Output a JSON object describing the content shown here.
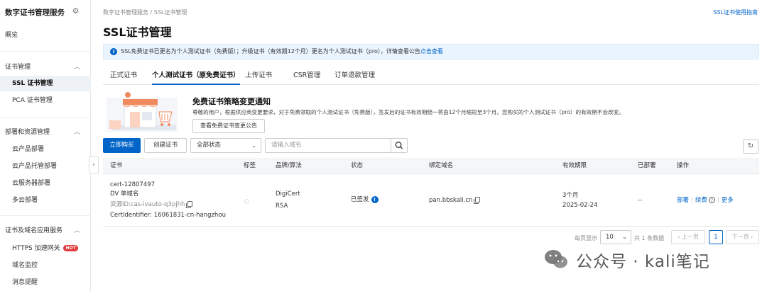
{
  "sidebar": {
    "title": "数字证书管理服务",
    "items": [
      {
        "label": "概览"
      },
      {
        "label": "证书管理"
      },
      {
        "label": "SSL 证书管理"
      },
      {
        "label": "PCA 证书管理"
      },
      {
        "label": "部署和资源管理"
      },
      {
        "label": "云产品部署"
      },
      {
        "label": "云产品托管部署"
      },
      {
        "label": "云服务器部署"
      },
      {
        "label": "多云部署"
      },
      {
        "label": "证书及域名应用服务"
      },
      {
        "label": "HTTPS 加速网关",
        "badge": "HOT"
      },
      {
        "label": "域名监控"
      },
      {
        "label": "消息提醒"
      }
    ]
  },
  "header": {
    "breadcrumb": "数字证书管理服务  /  SSL证书管理",
    "help_link": "SSL证书使用指南",
    "title": "SSL证书管理"
  },
  "notice": {
    "text": "SSL免费证书已更名为个人测试证书（免费版）；升级证书（有效期12个月）更名为个人测试证书（pro），详情查看公告",
    "link": "点击查看"
  },
  "tabs": [
    {
      "label": "正式证书"
    },
    {
      "label": "个人测试证书（原免费证书）"
    },
    {
      "label": "上传证书"
    },
    {
      "label": "CSR管理"
    },
    {
      "label": "订单退款管理"
    }
  ],
  "banner": {
    "title": "免费证书策略变更通知",
    "text": "尊敬的用户，根据供应商变更要求，对于免费领取的个人测试证书（免费版），签发后的证书有效期统一将由12个月缩短至3个月。您购买的个人测试证书（pro）的有效期不会改变。",
    "button": "查看免费证书变更公告"
  },
  "toolbar": {
    "buy": "立即购买",
    "create": "创建证书",
    "status_select": "全部状态",
    "search_placeholder": "请输入域名"
  },
  "table": {
    "headers": [
      "证书",
      "标签",
      "品牌/算法",
      "状态",
      "绑定域名",
      "有效期限",
      "已部署",
      "操作"
    ],
    "rows": [
      {
        "cert_name": "cert-12807497",
        "cert_type": "DV 单域名",
        "resource_id": "资源ID:cas-ivauto-q3pjhh",
        "cert_identifier": "CertIdentifier: 16061831-cn-hangzhou",
        "brand": "DigiCert",
        "algo": "RSA",
        "status": "已签发",
        "domain": "pan.bbskali.cn",
        "validity": "3个月",
        "expire": "2025-02-24",
        "deployed": "--",
        "actions": [
          "部署",
          "续费",
          "更多"
        ]
      }
    ]
  },
  "pager": {
    "per_page_label": "每页显示",
    "per_page": "10",
    "total": "共 1 条数据",
    "prev": "上一页",
    "page": "1",
    "next": "下一页"
  },
  "watermark": {
    "text": "公众号 · kali笔记"
  },
  "colors": {
    "primary": "#0064c8",
    "notice_bg": "#eaf4ff",
    "hot": "#e4393c"
  }
}
